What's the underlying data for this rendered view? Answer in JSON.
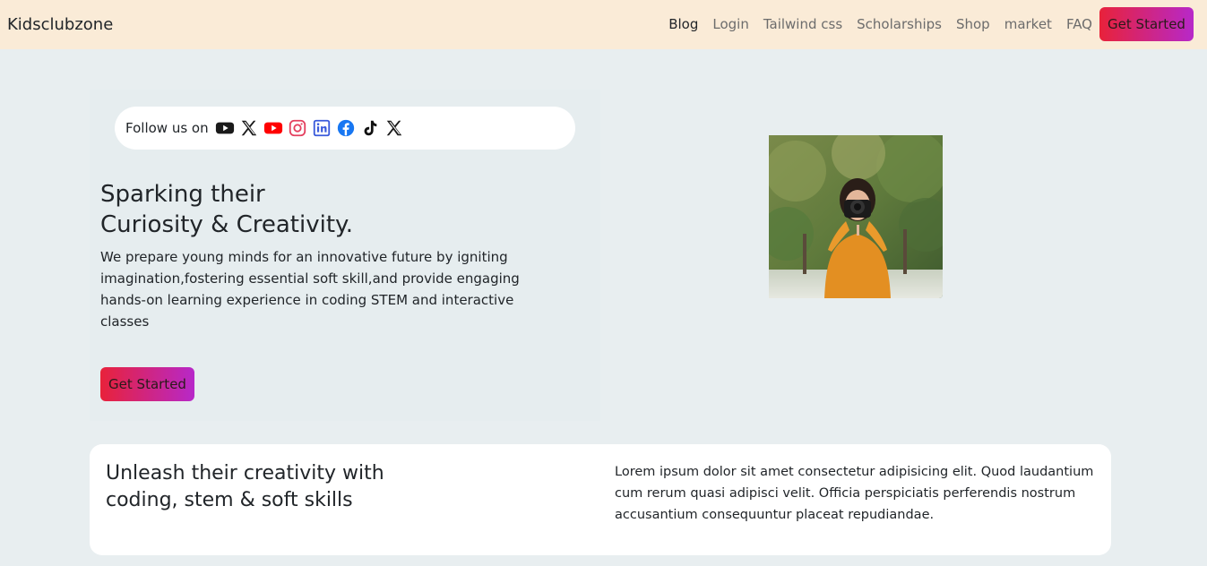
{
  "navbar": {
    "brand": "Kidsclubzone",
    "links": [
      "Blog",
      "Login",
      "Tailwind css",
      "Scholarships",
      "Shop",
      "market",
      "FAQ"
    ],
    "cta": "Get Started",
    "colors": {
      "background": "#faebd7",
      "cta_start": "#e8223a",
      "cta_end": "#b728c9"
    }
  },
  "hero": {
    "follow_label": "Follow us on",
    "social_icons": [
      "youtube-dark-icon",
      "x-icon",
      "youtube-red-icon",
      "instagram-icon",
      "linkedin-icon",
      "facebook-icon",
      "tiktok-icon",
      "x-icon"
    ],
    "title_line1": "Sparking their",
    "title_line2": "Curiosity & Creativity.",
    "description": "We prepare young minds for an innovative future by igniting imagination,fostering essential soft skill,and provide engaging hands-on learning experience in coding STEM and interactive classes",
    "cta": "Get Started",
    "image_alt": "Girl in orange sweater holding a camera"
  },
  "feature": {
    "title_line1": "Unleash their creativity with",
    "title_line2": "coding, stem & soft skills",
    "text": "Lorem ipsum dolor sit amet consectetur adipisicing elit. Quod laudantium cum rerum quasi adipisci velit. Officia perspiciatis perferendis nostrum accusantium consequuntur placeat repudiandae."
  }
}
